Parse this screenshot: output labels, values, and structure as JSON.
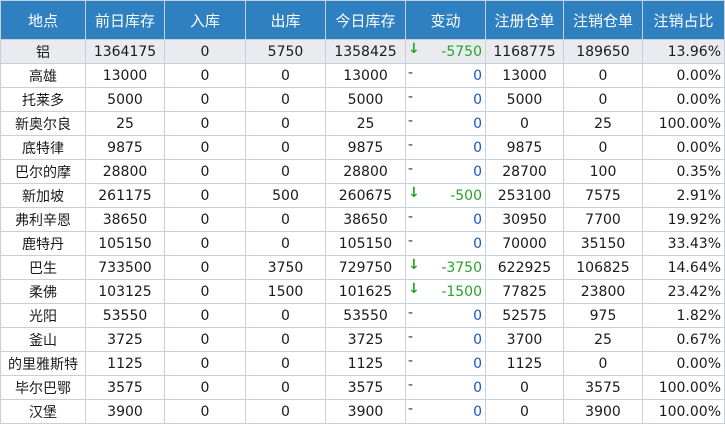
{
  "headers": [
    "地点",
    "前日库存",
    "入库",
    "出库",
    "今日库存",
    "变动",
    "注册仓单",
    "注销仓单",
    "注销占比"
  ],
  "colors": {
    "header_bg": "#2e80c0",
    "header_text": "#ffffff",
    "decrease": "#2aa22a",
    "no_change": "#1f4fd1",
    "selected_row_bg": "#e9ebef"
  },
  "rows": [
    {
      "name": "铝",
      "prev": "1364175",
      "in": "0",
      "out": "5750",
      "today": "1358425",
      "dir": "↓",
      "chg": "-5750",
      "reg": "1168775",
      "can": "189650",
      "ratio": "13.96%"
    },
    {
      "name": "高雄",
      "prev": "13000",
      "in": "0",
      "out": "0",
      "today": "13000",
      "dir": "-",
      "chg": "0",
      "reg": "13000",
      "can": "0",
      "ratio": "0.00%"
    },
    {
      "name": "托莱多",
      "prev": "5000",
      "in": "0",
      "out": "0",
      "today": "5000",
      "dir": "-",
      "chg": "0",
      "reg": "5000",
      "can": "0",
      "ratio": "0.00%"
    },
    {
      "name": "新奥尔良",
      "prev": "25",
      "in": "0",
      "out": "0",
      "today": "25",
      "dir": "-",
      "chg": "0",
      "reg": "0",
      "can": "25",
      "ratio": "100.00%"
    },
    {
      "name": "底特律",
      "prev": "9875",
      "in": "0",
      "out": "0",
      "today": "9875",
      "dir": "-",
      "chg": "0",
      "reg": "9875",
      "can": "0",
      "ratio": "0.00%"
    },
    {
      "name": "巴尔的摩",
      "prev": "28800",
      "in": "0",
      "out": "0",
      "today": "28800",
      "dir": "-",
      "chg": "0",
      "reg": "28700",
      "can": "100",
      "ratio": "0.35%"
    },
    {
      "name": "新加坡",
      "prev": "261175",
      "in": "0",
      "out": "500",
      "today": "260675",
      "dir": "↓",
      "chg": "-500",
      "reg": "253100",
      "can": "7575",
      "ratio": "2.91%"
    },
    {
      "name": "弗利辛恩",
      "prev": "38650",
      "in": "0",
      "out": "0",
      "today": "38650",
      "dir": "-",
      "chg": "0",
      "reg": "30950",
      "can": "7700",
      "ratio": "19.92%"
    },
    {
      "name": "鹿特丹",
      "prev": "105150",
      "in": "0",
      "out": "0",
      "today": "105150",
      "dir": "-",
      "chg": "0",
      "reg": "70000",
      "can": "35150",
      "ratio": "33.43%"
    },
    {
      "name": "巴生",
      "prev": "733500",
      "in": "0",
      "out": "3750",
      "today": "729750",
      "dir": "↓",
      "chg": "-3750",
      "reg": "622925",
      "can": "106825",
      "ratio": "14.64%"
    },
    {
      "name": "柔佛",
      "prev": "103125",
      "in": "0",
      "out": "1500",
      "today": "101625",
      "dir": "↓",
      "chg": "-1500",
      "reg": "77825",
      "can": "23800",
      "ratio": "23.42%"
    },
    {
      "name": "光阳",
      "prev": "53550",
      "in": "0",
      "out": "0",
      "today": "53550",
      "dir": "-",
      "chg": "0",
      "reg": "52575",
      "can": "975",
      "ratio": "1.82%"
    },
    {
      "name": "釜山",
      "prev": "3725",
      "in": "0",
      "out": "0",
      "today": "3725",
      "dir": "-",
      "chg": "0",
      "reg": "3700",
      "can": "25",
      "ratio": "0.67%"
    },
    {
      "name": "的里雅斯特",
      "prev": "1125",
      "in": "0",
      "out": "0",
      "today": "1125",
      "dir": "-",
      "chg": "0",
      "reg": "1125",
      "can": "0",
      "ratio": "0.00%"
    },
    {
      "name": "毕尔巴鄂",
      "prev": "3575",
      "in": "0",
      "out": "0",
      "today": "3575",
      "dir": "-",
      "chg": "0",
      "reg": "0",
      "can": "3575",
      "ratio": "100.00%"
    },
    {
      "name": "汉堡",
      "prev": "3900",
      "in": "0",
      "out": "0",
      "today": "3900",
      "dir": "-",
      "chg": "0",
      "reg": "0",
      "can": "3900",
      "ratio": "100.00%"
    }
  ]
}
